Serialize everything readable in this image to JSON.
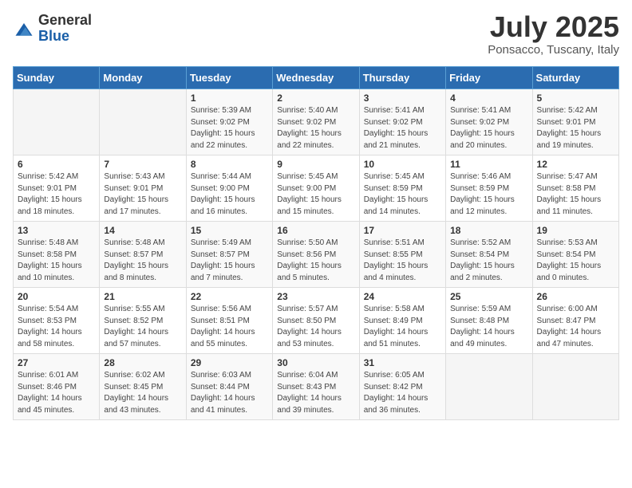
{
  "header": {
    "logo_general": "General",
    "logo_blue": "Blue",
    "month_year": "July 2025",
    "location": "Ponsacco, Tuscany, Italy"
  },
  "weekdays": [
    "Sunday",
    "Monday",
    "Tuesday",
    "Wednesday",
    "Thursday",
    "Friday",
    "Saturday"
  ],
  "weeks": [
    [
      {
        "day": "",
        "sunrise": "",
        "sunset": "",
        "daylight": ""
      },
      {
        "day": "",
        "sunrise": "",
        "sunset": "",
        "daylight": ""
      },
      {
        "day": "1",
        "sunrise": "Sunrise: 5:39 AM",
        "sunset": "Sunset: 9:02 PM",
        "daylight": "Daylight: 15 hours and 22 minutes."
      },
      {
        "day": "2",
        "sunrise": "Sunrise: 5:40 AM",
        "sunset": "Sunset: 9:02 PM",
        "daylight": "Daylight: 15 hours and 22 minutes."
      },
      {
        "day": "3",
        "sunrise": "Sunrise: 5:41 AM",
        "sunset": "Sunset: 9:02 PM",
        "daylight": "Daylight: 15 hours and 21 minutes."
      },
      {
        "day": "4",
        "sunrise": "Sunrise: 5:41 AM",
        "sunset": "Sunset: 9:02 PM",
        "daylight": "Daylight: 15 hours and 20 minutes."
      },
      {
        "day": "5",
        "sunrise": "Sunrise: 5:42 AM",
        "sunset": "Sunset: 9:01 PM",
        "daylight": "Daylight: 15 hours and 19 minutes."
      }
    ],
    [
      {
        "day": "6",
        "sunrise": "Sunrise: 5:42 AM",
        "sunset": "Sunset: 9:01 PM",
        "daylight": "Daylight: 15 hours and 18 minutes."
      },
      {
        "day": "7",
        "sunrise": "Sunrise: 5:43 AM",
        "sunset": "Sunset: 9:01 PM",
        "daylight": "Daylight: 15 hours and 17 minutes."
      },
      {
        "day": "8",
        "sunrise": "Sunrise: 5:44 AM",
        "sunset": "Sunset: 9:00 PM",
        "daylight": "Daylight: 15 hours and 16 minutes."
      },
      {
        "day": "9",
        "sunrise": "Sunrise: 5:45 AM",
        "sunset": "Sunset: 9:00 PM",
        "daylight": "Daylight: 15 hours and 15 minutes."
      },
      {
        "day": "10",
        "sunrise": "Sunrise: 5:45 AM",
        "sunset": "Sunset: 8:59 PM",
        "daylight": "Daylight: 15 hours and 14 minutes."
      },
      {
        "day": "11",
        "sunrise": "Sunrise: 5:46 AM",
        "sunset": "Sunset: 8:59 PM",
        "daylight": "Daylight: 15 hours and 12 minutes."
      },
      {
        "day": "12",
        "sunrise": "Sunrise: 5:47 AM",
        "sunset": "Sunset: 8:58 PM",
        "daylight": "Daylight: 15 hours and 11 minutes."
      }
    ],
    [
      {
        "day": "13",
        "sunrise": "Sunrise: 5:48 AM",
        "sunset": "Sunset: 8:58 PM",
        "daylight": "Daylight: 15 hours and 10 minutes."
      },
      {
        "day": "14",
        "sunrise": "Sunrise: 5:48 AM",
        "sunset": "Sunset: 8:57 PM",
        "daylight": "Daylight: 15 hours and 8 minutes."
      },
      {
        "day": "15",
        "sunrise": "Sunrise: 5:49 AM",
        "sunset": "Sunset: 8:57 PM",
        "daylight": "Daylight: 15 hours and 7 minutes."
      },
      {
        "day": "16",
        "sunrise": "Sunrise: 5:50 AM",
        "sunset": "Sunset: 8:56 PM",
        "daylight": "Daylight: 15 hours and 5 minutes."
      },
      {
        "day": "17",
        "sunrise": "Sunrise: 5:51 AM",
        "sunset": "Sunset: 8:55 PM",
        "daylight": "Daylight: 15 hours and 4 minutes."
      },
      {
        "day": "18",
        "sunrise": "Sunrise: 5:52 AM",
        "sunset": "Sunset: 8:54 PM",
        "daylight": "Daylight: 15 hours and 2 minutes."
      },
      {
        "day": "19",
        "sunrise": "Sunrise: 5:53 AM",
        "sunset": "Sunset: 8:54 PM",
        "daylight": "Daylight: 15 hours and 0 minutes."
      }
    ],
    [
      {
        "day": "20",
        "sunrise": "Sunrise: 5:54 AM",
        "sunset": "Sunset: 8:53 PM",
        "daylight": "Daylight: 14 hours and 58 minutes."
      },
      {
        "day": "21",
        "sunrise": "Sunrise: 5:55 AM",
        "sunset": "Sunset: 8:52 PM",
        "daylight": "Daylight: 14 hours and 57 minutes."
      },
      {
        "day": "22",
        "sunrise": "Sunrise: 5:56 AM",
        "sunset": "Sunset: 8:51 PM",
        "daylight": "Daylight: 14 hours and 55 minutes."
      },
      {
        "day": "23",
        "sunrise": "Sunrise: 5:57 AM",
        "sunset": "Sunset: 8:50 PM",
        "daylight": "Daylight: 14 hours and 53 minutes."
      },
      {
        "day": "24",
        "sunrise": "Sunrise: 5:58 AM",
        "sunset": "Sunset: 8:49 PM",
        "daylight": "Daylight: 14 hours and 51 minutes."
      },
      {
        "day": "25",
        "sunrise": "Sunrise: 5:59 AM",
        "sunset": "Sunset: 8:48 PM",
        "daylight": "Daylight: 14 hours and 49 minutes."
      },
      {
        "day": "26",
        "sunrise": "Sunrise: 6:00 AM",
        "sunset": "Sunset: 8:47 PM",
        "daylight": "Daylight: 14 hours and 47 minutes."
      }
    ],
    [
      {
        "day": "27",
        "sunrise": "Sunrise: 6:01 AM",
        "sunset": "Sunset: 8:46 PM",
        "daylight": "Daylight: 14 hours and 45 minutes."
      },
      {
        "day": "28",
        "sunrise": "Sunrise: 6:02 AM",
        "sunset": "Sunset: 8:45 PM",
        "daylight": "Daylight: 14 hours and 43 minutes."
      },
      {
        "day": "29",
        "sunrise": "Sunrise: 6:03 AM",
        "sunset": "Sunset: 8:44 PM",
        "daylight": "Daylight: 14 hours and 41 minutes."
      },
      {
        "day": "30",
        "sunrise": "Sunrise: 6:04 AM",
        "sunset": "Sunset: 8:43 PM",
        "daylight": "Daylight: 14 hours and 39 minutes."
      },
      {
        "day": "31",
        "sunrise": "Sunrise: 6:05 AM",
        "sunset": "Sunset: 8:42 PM",
        "daylight": "Daylight: 14 hours and 36 minutes."
      },
      {
        "day": "",
        "sunrise": "",
        "sunset": "",
        "daylight": ""
      },
      {
        "day": "",
        "sunrise": "",
        "sunset": "",
        "daylight": ""
      }
    ]
  ]
}
